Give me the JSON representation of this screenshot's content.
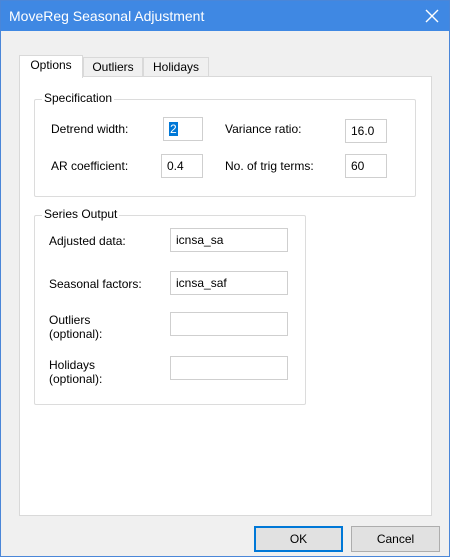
{
  "window": {
    "title": "MoveReg Seasonal Adjustment"
  },
  "tabs": [
    {
      "label": "Options",
      "active": true
    },
    {
      "label": "Outliers",
      "active": false
    },
    {
      "label": "Holidays",
      "active": false
    }
  ],
  "specification": {
    "label": "Specification",
    "detrend_width": {
      "label": "Detrend width:",
      "value": "2"
    },
    "variance_ratio": {
      "label": "Variance ratio:",
      "value": "16.0"
    },
    "ar_coefficient": {
      "label": "AR coefficient:",
      "value": "0.4"
    },
    "trig_terms": {
      "label": "No. of trig terms:",
      "value": "60"
    }
  },
  "series_output": {
    "label": "Series Output",
    "adjusted": {
      "label": "Adjusted data:",
      "value": "icnsa_sa"
    },
    "seasonal": {
      "label": "Seasonal factors:",
      "value": "icnsa_saf"
    },
    "outliers": {
      "label": "Outliers (optional):",
      "value": ""
    },
    "holidays": {
      "label": "Holidays (optional):",
      "value": ""
    }
  },
  "buttons": {
    "ok": "OK",
    "cancel": "Cancel"
  },
  "colors": {
    "titlebar": "#3f88e3",
    "selection": "#0078d7",
    "focus_border": "#0078d7"
  },
  "icons": {
    "close": "close-icon"
  }
}
